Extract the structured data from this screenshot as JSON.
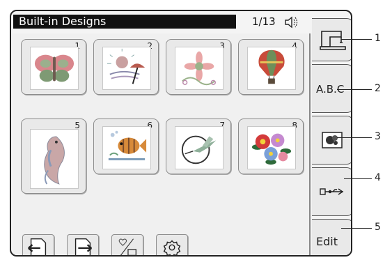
{
  "header": {
    "title": "Built-in Designs",
    "page_indicator": "1/13",
    "sound_icon": "speaker-icon"
  },
  "designs": [
    {
      "number": "1",
      "icon": "butterfly-icon"
    },
    {
      "number": "2",
      "icon": "beach-umbrella-icon"
    },
    {
      "number": "3",
      "icon": "flower-swirl-icon"
    },
    {
      "number": "4",
      "icon": "hot-air-balloon-icon"
    },
    {
      "number": "5",
      "icon": "parrot-icon"
    },
    {
      "number": "6",
      "icon": "fish-icon"
    },
    {
      "number": "7",
      "icon": "hummingbird-icon"
    },
    {
      "number": "8",
      "icon": "flower-bouquet-icon"
    }
  ],
  "toolbar": [
    {
      "icon": "page-previous-icon"
    },
    {
      "icon": "page-next-icon"
    },
    {
      "icon": "favorite-save-icon"
    },
    {
      "icon": "settings-gear-icon"
    }
  ],
  "side_tabs": [
    {
      "icon": "sewing-machine-icon",
      "label": "",
      "callout": "1"
    },
    {
      "icon": "",
      "label": "A.B.C",
      "callout": "2"
    },
    {
      "icon": "memory-design-icon",
      "label": "",
      "callout": "3"
    },
    {
      "icon": "usb-icon",
      "label": "",
      "callout": "4"
    },
    {
      "icon": "",
      "label": "Edit",
      "callout": "5"
    }
  ]
}
